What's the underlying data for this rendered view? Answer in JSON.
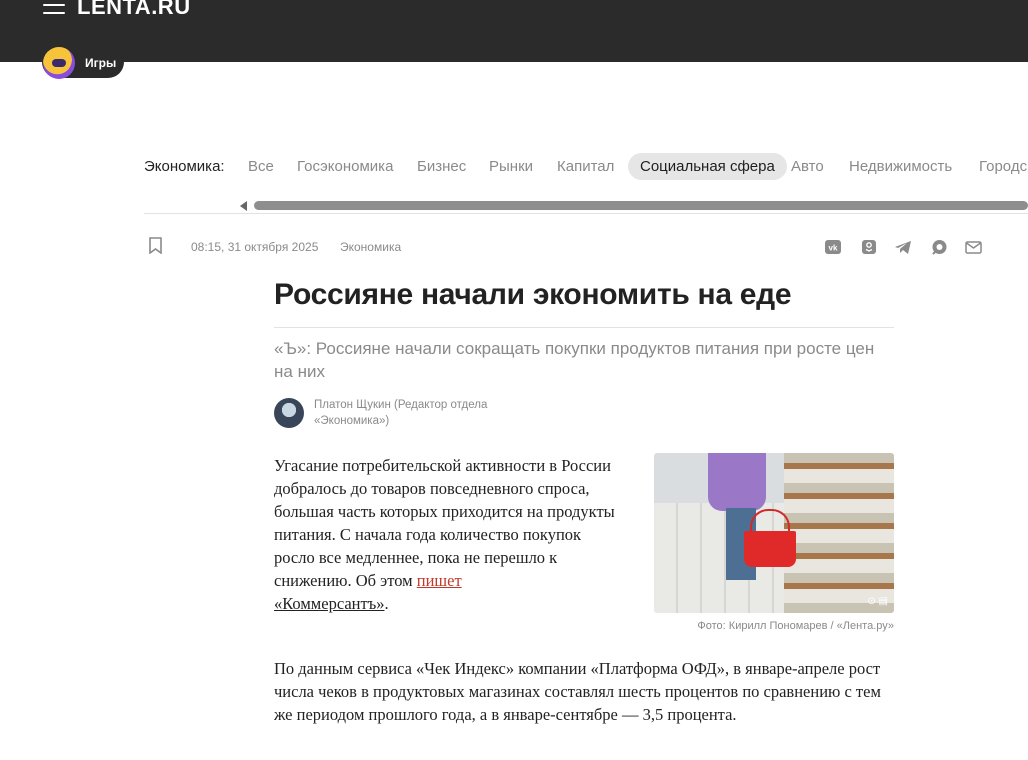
{
  "header": {
    "logo_text": "LENTA.RU",
    "games_label": "Игры"
  },
  "rubrics": {
    "section_label": "Экономика:",
    "items": [
      "Все",
      "Госэкономика",
      "Бизнес",
      "Рынки",
      "Капитал",
      "Социальная сфера",
      "Авто",
      "Недвижимость",
      "Городс"
    ],
    "active": "Социальная сфера"
  },
  "meta": {
    "date": "08:15, 31 октября 2025",
    "rubric": "Экономика"
  },
  "share_icons": [
    "vk-icon",
    "ok-icon",
    "telegram-icon",
    "max-icon",
    "mail-icon"
  ],
  "article": {
    "title": "Россияне начали экономить на еде",
    "lead": "«Ъ»: Россияне начали сокращать покупки продуктов питания при росте цен на них",
    "author": "Платон Щукин (Редактор отдела «Экономика»)",
    "p1_text": "Угасание потребительской активности в России добралось до товаров повседневного спроса, большая часть которых приходится на продукты питания. С начала года количество покупок росло все медленнее, пока не перешло к снижению. Об этом ",
    "p1_link": "пишет",
    "p1_tail": "«Коммерсантъ»",
    "p1_end": ".",
    "p2_text": "По данным сервиса «Чек Индекс» компании «Платформа ОФД», в январе-апреле рост числа чеков в продуктовых магазинах составлял шесть процентов по сравнению с тем же периодом прошлого года, а в январе-сентябре — 3,5 процента.",
    "photo_caption": "Фото: Кирилл Пономарев / «Лента.ру»"
  },
  "colors": {
    "topbar": "#2b2b2b",
    "link": "#c0392b",
    "muted": "#8a8a8a"
  }
}
